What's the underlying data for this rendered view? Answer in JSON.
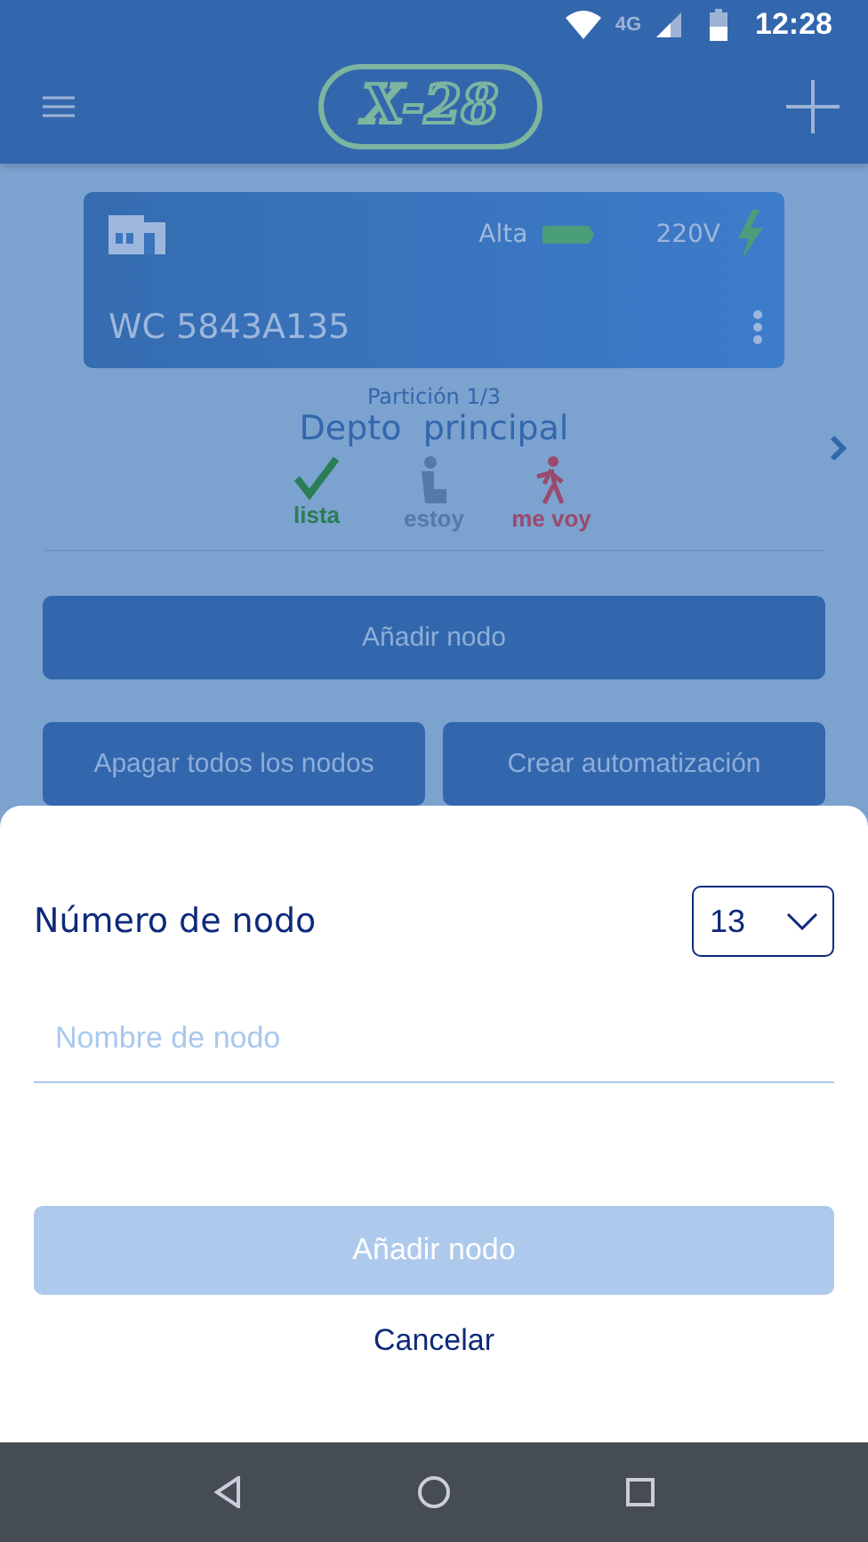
{
  "status_bar": {
    "network": "4G",
    "time": "12:28"
  },
  "toolbar": {
    "logo": "X-28"
  },
  "device_card": {
    "battery_label": "Alta",
    "voltage": "220V",
    "name": "WC 5843A135"
  },
  "partition": {
    "counter": "Partición 1/3",
    "name": "Depto  principal"
  },
  "modes": [
    {
      "kind": "check",
      "label": "lista",
      "color": "#2a7d55"
    },
    {
      "kind": "seated",
      "label": "estoy",
      "color": "#557aa8"
    },
    {
      "kind": "walking",
      "label": "me voy",
      "color": "#9a4a6e"
    }
  ],
  "actions": {
    "primary": "Añadir nodo",
    "secondary": [
      "Apagar todos los nodos",
      "Crear automatización"
    ]
  },
  "dialog": {
    "title": "Número de nodo",
    "number": "13",
    "name_field": {
      "placeholder": "Nombre de nodo"
    },
    "submit": {
      "label": "Añadir nodo",
      "disabled": true
    },
    "cancel": "Cancelar"
  }
}
